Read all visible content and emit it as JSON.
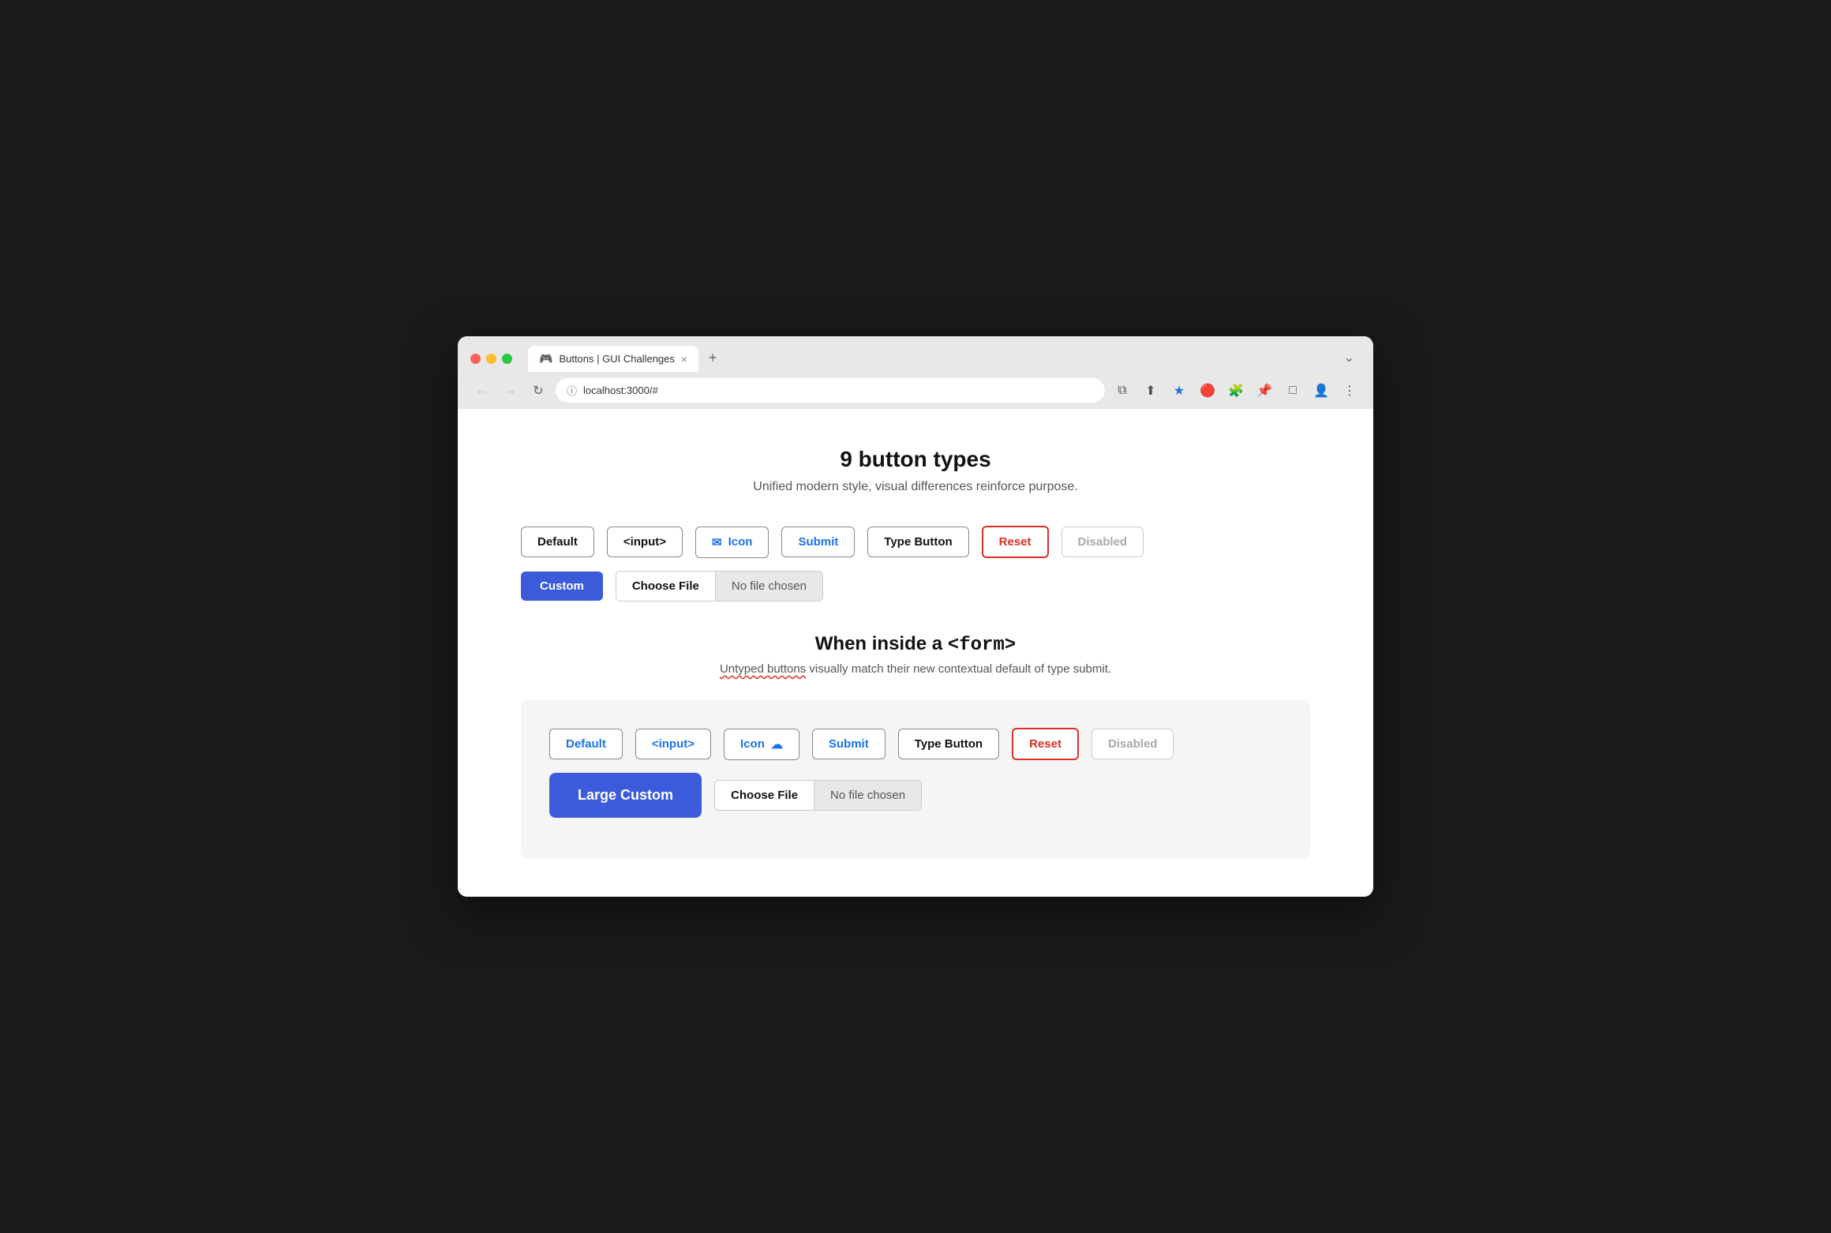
{
  "browser": {
    "traffic_lights": [
      "close",
      "minimize",
      "maximize"
    ],
    "tab": {
      "icon": "🎮",
      "title": "Buttons | GUI Challenges",
      "close": "×"
    },
    "new_tab": "+",
    "menu": "⌄",
    "address": "localhost:3000/#",
    "toolbar_icons": {
      "open_link": "⧉",
      "share": "⬆",
      "star": "★",
      "extension_red": "🔴",
      "puzzle": "🧩",
      "pin": "📌",
      "sidebar": "⬜",
      "profile": "👤",
      "more": "⋮"
    }
  },
  "page": {
    "title": "9 button types",
    "subtitle": "Unified modern style, visual differences reinforce purpose.",
    "buttons_row1": [
      {
        "label": "Default",
        "type": "default"
      },
      {
        "label": "<input>",
        "type": "input"
      },
      {
        "label": "Icon",
        "type": "icon"
      },
      {
        "label": "Submit",
        "type": "submit"
      },
      {
        "label": "Type Button",
        "type": "type-button"
      },
      {
        "label": "Reset",
        "type": "reset"
      },
      {
        "label": "Disabled",
        "type": "disabled"
      }
    ],
    "buttons_row2": [
      {
        "label": "Custom",
        "type": "custom"
      }
    ],
    "file_input": {
      "choose_label": "Choose File",
      "no_file_label": "No file chosen"
    },
    "form_section": {
      "title_prefix": "When inside a ",
      "title_code": "<form>",
      "subtitle_normal": " visually match their new contextual default of type submit.",
      "subtitle_underlined": "Untyped buttons",
      "buttons_row1": [
        {
          "label": "Default",
          "type": "form-default"
        },
        {
          "label": "<input>",
          "type": "form-input"
        },
        {
          "label": "Icon",
          "type": "form-icon"
        },
        {
          "label": "Submit",
          "type": "form-submit"
        },
        {
          "label": "Type Button",
          "type": "form-type"
        },
        {
          "label": "Reset",
          "type": "form-reset"
        },
        {
          "label": "Disabled",
          "type": "form-disabled"
        }
      ],
      "large_custom_label": "Large Custom",
      "file_input": {
        "choose_label": "Choose File",
        "no_file_label": "No file chosen"
      }
    }
  }
}
